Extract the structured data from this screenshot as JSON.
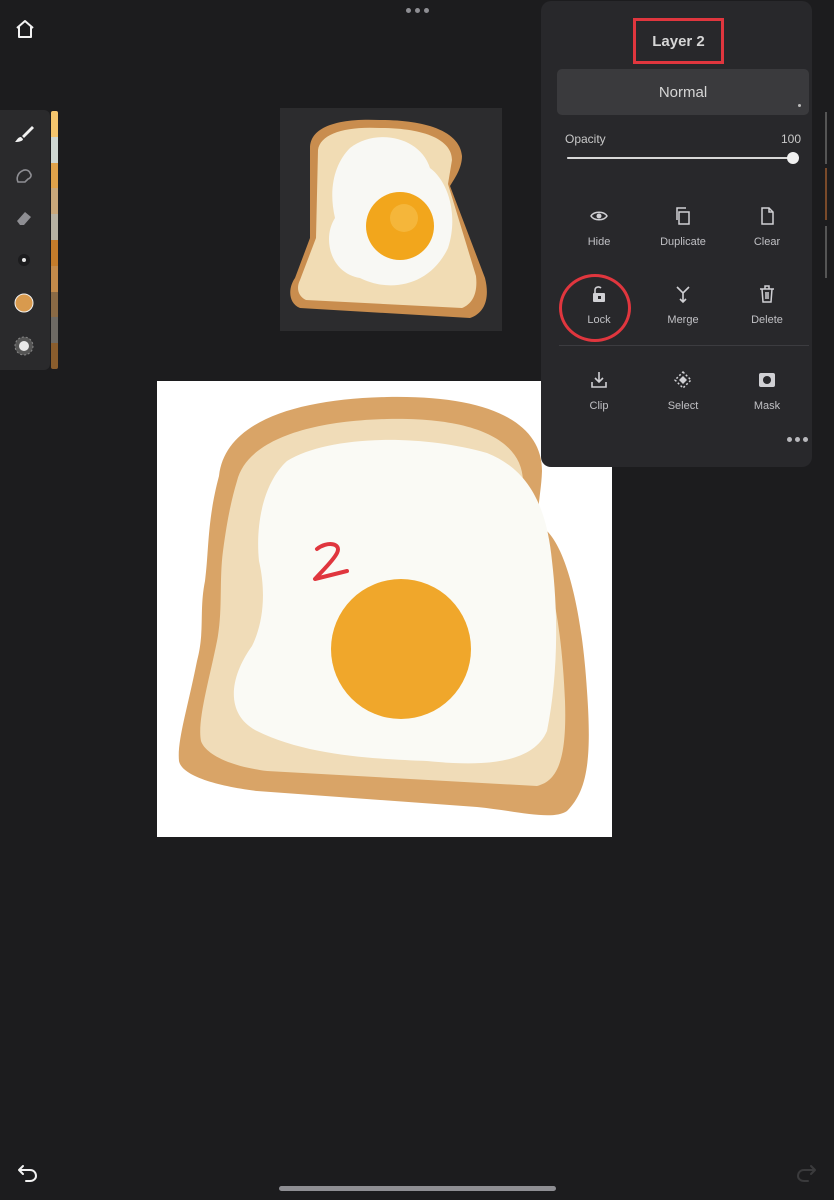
{
  "panel": {
    "layer_name": "Layer 2",
    "blend_mode": "Normal",
    "opacity_label": "Opacity",
    "opacity_value": "100",
    "opacity_level": 1.0,
    "actions_row1": [
      {
        "label": "Hide",
        "icon": "eye-icon"
      },
      {
        "label": "Duplicate",
        "icon": "duplicate-icon"
      },
      {
        "label": "Clear",
        "icon": "document-icon"
      }
    ],
    "actions_row2": [
      {
        "label": "Lock",
        "icon": "lock-icon"
      },
      {
        "label": "Merge",
        "icon": "merge-icon"
      },
      {
        "label": "Delete",
        "icon": "trash-icon"
      }
    ],
    "actions_row3": [
      {
        "label": "Clip",
        "icon": "clip-icon"
      },
      {
        "label": "Select",
        "icon": "select-icon"
      },
      {
        "label": "Mask",
        "icon": "mask-icon"
      }
    ]
  },
  "tools": [
    "brush-icon",
    "smudge-icon",
    "eraser-icon",
    "brush-size-icon",
    "color-icon",
    "opacity-icon"
  ],
  "current_color": "#d89a4e",
  "swatch_colors": [
    "#f4c56d",
    "#cfd7d2",
    "#e0a24a",
    "#c9a77a",
    "#b7b2a3",
    "#c47c2b",
    "#c38a4a",
    "#8a6a45",
    "#6e6a64",
    "#8a5d2d"
  ],
  "canvas": {
    "annotation": "2"
  }
}
